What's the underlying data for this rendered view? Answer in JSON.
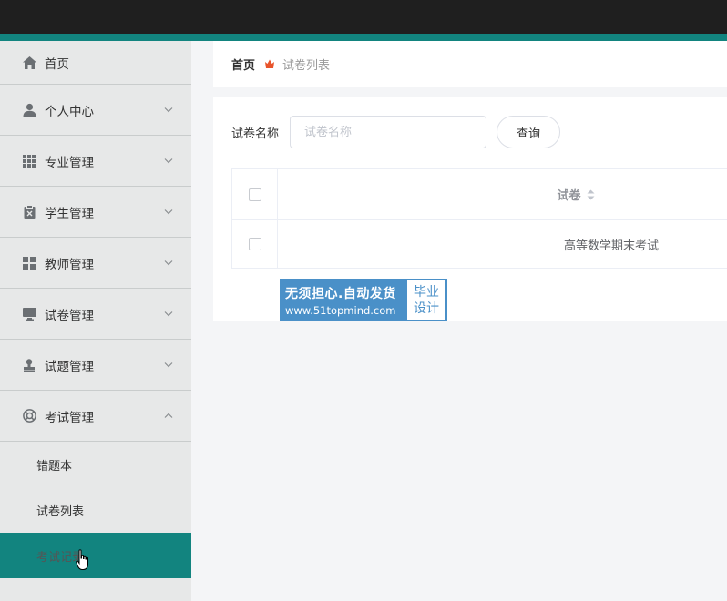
{
  "sidebar": {
    "items": [
      {
        "label": "首页",
        "icon": "home-icon"
      },
      {
        "label": "个人中心",
        "icon": "user-icon"
      },
      {
        "label": "专业管理",
        "icon": "grid-icon"
      },
      {
        "label": "学生管理",
        "icon": "clipboard-icon"
      },
      {
        "label": "教师管理",
        "icon": "apps-icon"
      },
      {
        "label": "试卷管理",
        "icon": "monitor-icon"
      },
      {
        "label": "试题管理",
        "icon": "stamp-icon"
      },
      {
        "label": "考试管理",
        "icon": "lifebuoy-icon"
      }
    ],
    "sub_items": [
      {
        "label": "错题本"
      },
      {
        "label": "试卷列表"
      },
      {
        "label": "考试记录"
      }
    ],
    "active_sub": "考试记录"
  },
  "breadcrumb": {
    "home": "首页",
    "current": "试卷列表"
  },
  "search": {
    "label": "试卷名称",
    "placeholder": "试卷名称",
    "value": "",
    "button": "查询"
  },
  "table": {
    "header": "试卷",
    "rows": [
      {
        "name": "高等数学期末考试"
      }
    ]
  },
  "watermark": {
    "line1": "无须担心.自动发货",
    "line2": "www.51topmind.com",
    "right_top": "毕业",
    "right_bottom": "设计"
  },
  "colors": {
    "accent": "#12847f",
    "topbar": "#1f1f1f",
    "sidebar_bg": "#e7e8e8",
    "breadcrumb_icon": "#e8542b",
    "watermark": "#4a90c8"
  }
}
